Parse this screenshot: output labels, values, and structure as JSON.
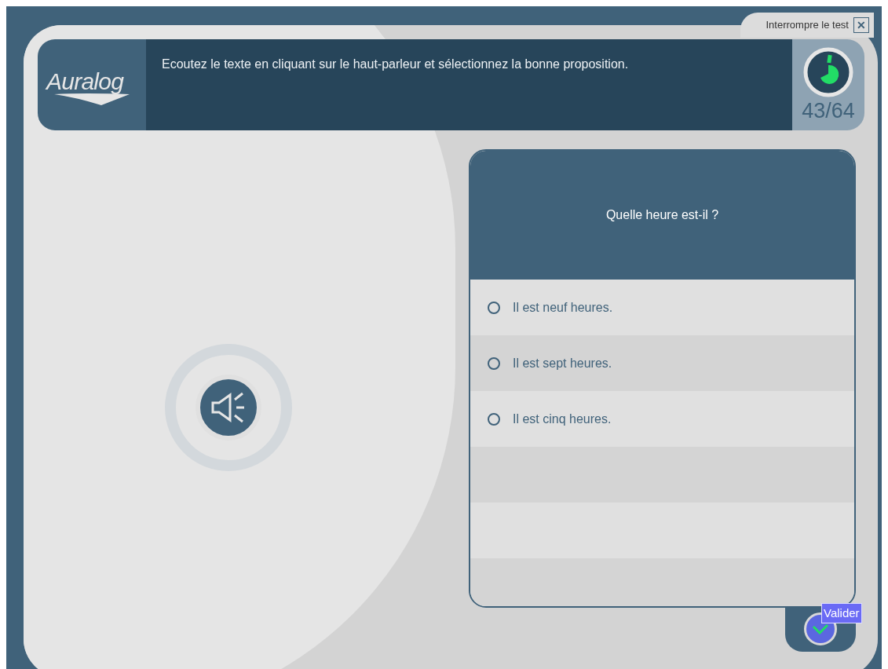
{
  "quit_link": {
    "label": "Interrompre le test",
    "close_symbol": "✕"
  },
  "header": {
    "logo": "Auralog",
    "instruction": "Ecoutez le texte en cliquant sur le haut-parleur et sélectionnez la bonne proposition.",
    "progress": "43/64"
  },
  "question": {
    "text": "Quelle heure est-il ?",
    "choices": [
      {
        "label": "Il est neuf heures.",
        "selected": false
      },
      {
        "label": "Il est sept heures.",
        "selected": false
      },
      {
        "label": "Il est cinq heures.",
        "selected": false
      }
    ]
  },
  "validate": {
    "tooltip": "Valider"
  }
}
